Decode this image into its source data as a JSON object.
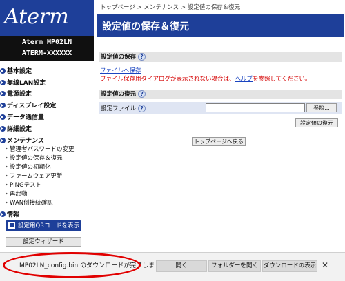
{
  "sidebar": {
    "logo": "Aterm",
    "model_line1": "Aterm   MP02LN",
    "model_line2": "ATERM-XXXXXX",
    "categories": {
      "basic": "基本設定",
      "wlan": "無線LAN設定",
      "power": "電源設定",
      "display": "ディスプレイ設定",
      "data": "データ通信量",
      "detail": "詳細設定",
      "maintenance": "メンテナンス",
      "info": "情報"
    },
    "maintenance_items": [
      "管理者パスワードの変更",
      "設定値の保存＆復元",
      "設定値の初期化",
      "ファームウェア更新",
      "PINGテスト",
      "再起動",
      "WAN側接続確認"
    ],
    "qr_button": "設定用QRコードを表示",
    "wizard_button": "設定ウィザード"
  },
  "main": {
    "breadcrumb": "トップページ > メンテナンス > 設定値の保存＆復元",
    "title": "設定値の保存＆復元",
    "save_section": {
      "heading": "設定値の保存",
      "help": "?",
      "file_link": "ファイルへ保存",
      "warning_before": "ファイル保存用ダイアログが表示されない場合は、",
      "help_link": "ヘルプ",
      "warning_after": "を参照してください。"
    },
    "restore_section": {
      "heading": "設定値の復元",
      "help": "?",
      "file_label": "設定ファイル",
      "file_value": "",
      "browse_button": "参照...",
      "restore_button": "設定値の復元"
    },
    "top_button": "トップページへ戻る"
  },
  "download_bar": {
    "message": "MP02LN_config.bin のダウンロードが完了しまし",
    "open": "開く",
    "open_folder": "フォルダーを開く",
    "show_downloads": "ダウンロードの表示",
    "close": "✕"
  },
  "colors": {
    "brand_blue": "#1e3f99",
    "warning_red": "#d40000",
    "link_blue": "#1a44c0",
    "annotation_red": "#e10000"
  }
}
